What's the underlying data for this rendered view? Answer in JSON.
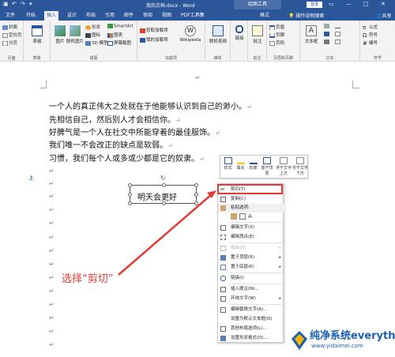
{
  "titlebar": {
    "title": "我的文档.docx - Word",
    "context_tab": "绘图工具",
    "login": "登录",
    "minimize": "—",
    "restore": "□",
    "close": "✕"
  },
  "tabs": [
    "文件",
    "开始",
    "插入",
    "设计",
    "布局",
    "引用",
    "邮件",
    "审阅",
    "视图",
    "PDF工具集",
    "格式"
  ],
  "active_tab": "插入",
  "tell_me": "操作说明搜索",
  "share": "共享",
  "ribbon": {
    "pages": {
      "label": "页面",
      "items": [
        "封面",
        "空白页",
        "分页"
      ]
    },
    "table": {
      "label": "表格",
      "button": "表格"
    },
    "illustrations": {
      "label": "插图",
      "items": [
        "图片",
        "联机图片",
        "形状",
        "图标",
        "3D 模型",
        "SmartArt",
        "图表",
        "屏幕截图"
      ]
    },
    "addins": {
      "label": "加载项",
      "items": [
        "获取加载项",
        "我的加载项",
        "Wikipedia"
      ]
    },
    "media": {
      "label": "媒体",
      "button": "联机视频"
    },
    "links": {
      "label": "",
      "button": "链接"
    },
    "comments": {
      "label": "批注",
      "button": "批注"
    },
    "header_footer": {
      "label": "页眉和页脚",
      "items": [
        "页眉",
        "页脚",
        "页码"
      ]
    },
    "text": {
      "label": "文本",
      "items": [
        "文本框"
      ]
    },
    "symbols": {
      "label": "符号",
      "items": [
        "公式",
        "符号",
        "编号"
      ]
    }
  },
  "document": {
    "paragraphs": [
      "一个人的真正伟大之处就在于他能够认识到自己的渺小。",
      "先相信自己，然后别人才会相信你。",
      "好脾气是一个人在社交中所能穿着的最佳服饰。",
      "我们唯一不会改正的缺点是软弱。",
      "习惯，我们每个人或多或少都是它的奴隶。"
    ],
    "para_mark": "↵",
    "textbox_text": "明天会更好"
  },
  "minibar": {
    "buttons": [
      "样式",
      "填充",
      "轮廓",
      "置于顶层",
      "浮于文字上方",
      "衬于文字下方"
    ]
  },
  "context_menu": {
    "items": [
      {
        "label": "剪切(T)",
        "icon": "scissors-icon",
        "arrow": false,
        "disabled": false
      },
      {
        "label": "复制(C)",
        "icon": "copy-icon",
        "arrow": false,
        "disabled": false
      },
      {
        "label": "粘贴选项:",
        "icon": "paste-icon",
        "arrow": false,
        "disabled": false
      },
      {
        "label": "编辑文字(X)",
        "icon": "edit-text-icon",
        "arrow": false,
        "disabled": false
      },
      {
        "label": "编辑顶点(E)",
        "icon": "edit-points-icon",
        "arrow": false,
        "disabled": false
      },
      {
        "label": "组合(G)",
        "icon": "group-icon",
        "arrow": true,
        "disabled": true
      },
      {
        "label": "置于顶层(R)",
        "icon": "bring-front-icon",
        "arrow": true,
        "disabled": false
      },
      {
        "label": "置于底层(K)",
        "icon": "send-back-icon",
        "arrow": true,
        "disabled": false
      },
      {
        "label": "链接(I)",
        "icon": "link-icon",
        "arrow": false,
        "disabled": false
      },
      {
        "label": "插入题注(N)...",
        "icon": "caption-icon",
        "arrow": false,
        "disabled": false
      },
      {
        "label": "环绕文字(W)",
        "icon": "wrap-text-icon",
        "arrow": true,
        "disabled": false
      },
      {
        "label": "编辑替换文字(A)...",
        "icon": "alt-text-icon",
        "arrow": false,
        "disabled": false
      },
      {
        "label": "设置为默认文本框(D)",
        "icon": "",
        "arrow": false,
        "disabled": false
      },
      {
        "label": "其他布局选项(L)...",
        "icon": "layout-options-icon",
        "arrow": false,
        "disabled": false
      },
      {
        "label": "设置形状格式(O)...",
        "icon": "format-shape-icon",
        "arrow": false,
        "disabled": false
      }
    ]
  },
  "annotation": "选择“剪切”",
  "watermark": {
    "title": "纯净系统everything",
    "url": "www.yidaimei.com"
  },
  "colors": {
    "brand": "#2b579a",
    "highlight": "#e53935",
    "watermark": "#1a5fb4"
  }
}
